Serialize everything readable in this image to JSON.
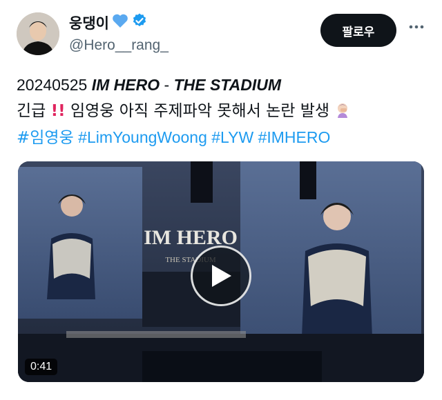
{
  "user": {
    "display_name": "웅댕이",
    "handle": "@Hero__rang_",
    "heart_emoji": "💙"
  },
  "actions": {
    "follow_label": "팔로우"
  },
  "tweet": {
    "date": "20240525",
    "event_title": "IM HERO",
    "event_sep": " - ",
    "event_subtitle": "THE STADIUM",
    "alert_prefix": "긴급",
    "alert_emoji": "‼️",
    "alert_text": "임영웅 아직 주제파악 못해서 논란 발생",
    "facepalm_emoji": "🤦🏻‍♀️",
    "hashtags": [
      "#임영웅",
      "#LimYoungWoong",
      "#LYW",
      "#IMHERO"
    ]
  },
  "media": {
    "stage_logo": "IM HERO",
    "stage_subtitle": "THE STADIUM",
    "duration": "0:41"
  },
  "colors": {
    "accent": "#1d9bf0",
    "verified": "#1d9bf0",
    "text": "#0f1419",
    "muted": "#536471"
  }
}
